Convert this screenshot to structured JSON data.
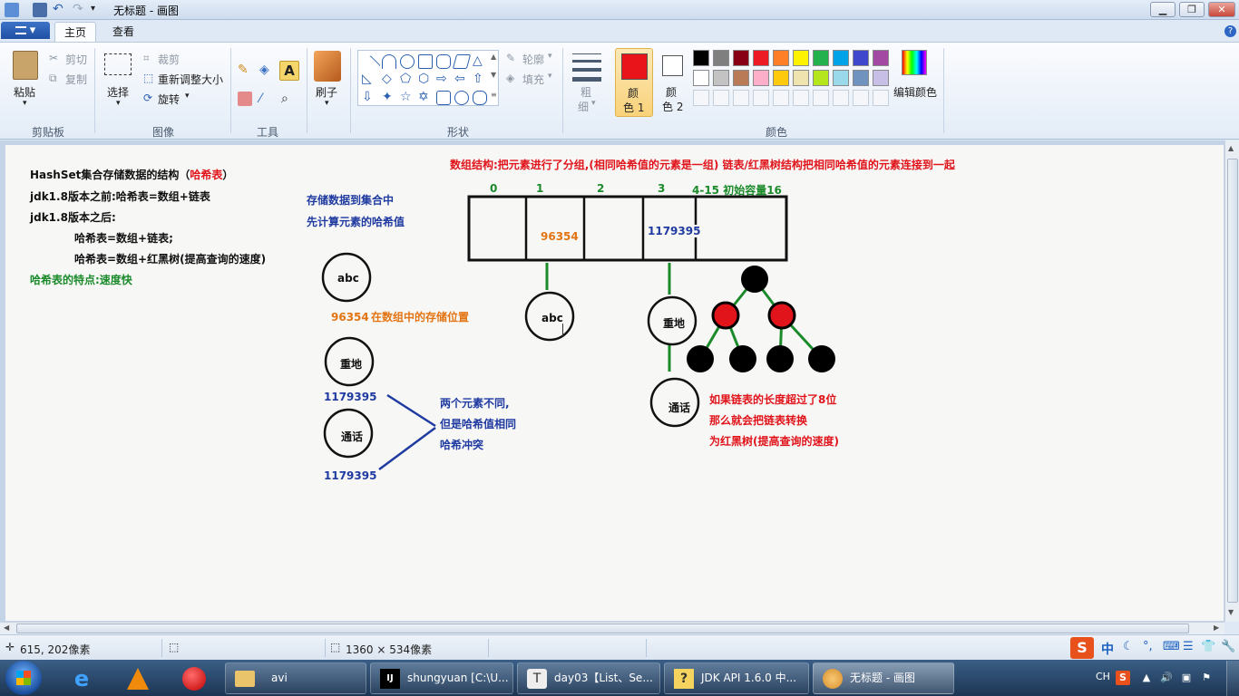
{
  "window": {
    "title": "无标题 - 画图"
  },
  "menu": {
    "file_label": "▾"
  },
  "tabs": [
    {
      "label": "主页"
    },
    {
      "label": "查看"
    }
  ],
  "ribbon": {
    "clipboard": {
      "paste": "粘贴",
      "cut": "剪切",
      "copy": "复制",
      "group": "剪贴板"
    },
    "image": {
      "select": "选择",
      "crop": "裁剪",
      "resize": "重新调整大小",
      "rotate": "旋转",
      "group": "图像"
    },
    "tools": {
      "group": "工具"
    },
    "brushes": {
      "label": "刷子"
    },
    "shapes": {
      "outline": "轮廓",
      "fill": "填充",
      "group": "形状"
    },
    "size": {
      "label1": "粗",
      "label2": "细"
    },
    "color1": {
      "label1": "颜",
      "label2": "色 1",
      "value": "#e8141a"
    },
    "color2": {
      "label1": "颜",
      "label2": "色 2",
      "value": "#ffffff"
    },
    "colors": {
      "group": "颜色",
      "edit": "编辑颜色",
      "palette_row1": [
        "#000000",
        "#7f7f7f",
        "#880015",
        "#ed1c24",
        "#ff7f27",
        "#fff200",
        "#22b14c",
        "#00a2e8",
        "#3f48cc",
        "#a349a4"
      ],
      "palette_row2": [
        "#ffffff",
        "#c3c3c3",
        "#b97a57",
        "#ffaec9",
        "#ffc90e",
        "#efe4b0",
        "#b5e61d",
        "#99d9ea",
        "#7092be",
        "#c8bfe7"
      ]
    }
  },
  "drawing": {
    "heading1": "HashSet集合存储数据的结构（",
    "heading1_red": "哈希表",
    "heading1_end": "）",
    "line2": "jdk1.8版本之前:哈希表=数组+链表",
    "line3": "jdk1.8版本之后:",
    "line4": "哈希表=数组+链表;",
    "line5": "哈希表=数组+红黑树(提高查询的速度)",
    "line6": "哈希表的特点:速度快",
    "top_note": "数组结构:把元素进行了分组,(相同哈希值的元素是一组) 链表/红黑树结构把相同哈希值的元素连接到一起",
    "store_note1": "存储数据到集合中",
    "store_note2": "先计算元素的哈希值",
    "idx0": "0",
    "idx1": "1",
    "idx2": "2",
    "idx3": "3",
    "idx_rest": "4-15 初始容量16",
    "cell1": "96354",
    "cell3": "1179395",
    "node_abc": "abc",
    "hash_abc": "96354",
    "position_note": "在数组中的存储位置",
    "node_zhongdi": "重地",
    "hash_zhongdi": "1179395",
    "node_tonghua": "通话",
    "hash_tonghua": "1179395",
    "conflict1": "两个元素不同,",
    "conflict2": "但是哈希值相同",
    "conflict3": "哈希冲突",
    "chain_abc": "abc",
    "chain_zhongdi": "重地",
    "chain_tonghua": "通话",
    "tree_note1": "如果链表的长度超过了8位",
    "tree_note2": "那么就会把链表转换",
    "tree_note3": "为红黑树(提高查询的速度)"
  },
  "status": {
    "cursor": "615, 202像素",
    "size": "1360 × 534像素"
  },
  "taskbar": {
    "items": [
      {
        "label": "avi"
      },
      {
        "label": "shungyuan [C:\\U..."
      },
      {
        "label": "day03【List、Se..."
      },
      {
        "label": "JDK API 1.6.0 中..."
      },
      {
        "label": "无标题 - 画图"
      }
    ],
    "lang": "CH"
  }
}
